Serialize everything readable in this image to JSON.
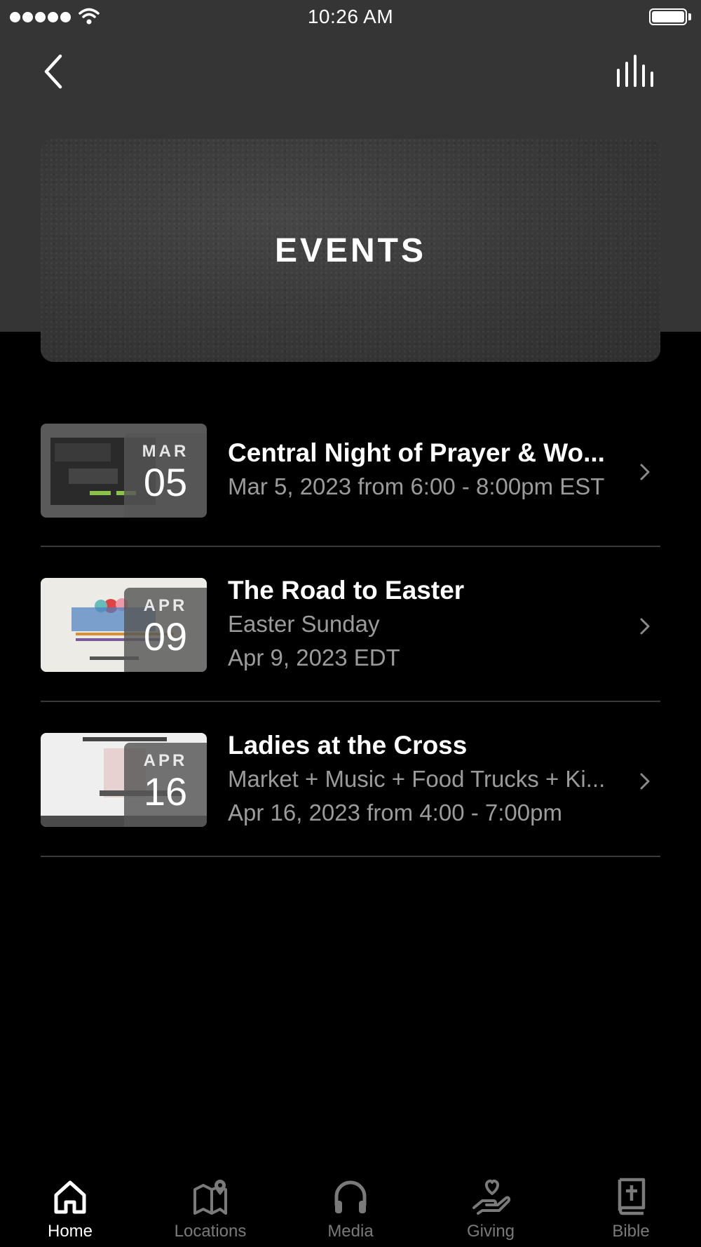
{
  "status_bar": {
    "time": "10:26 AM"
  },
  "header": {
    "back_icon": "chevron-left-icon",
    "audio_icon": "audio-bars-icon"
  },
  "banner": {
    "title": "EVENTS"
  },
  "events": [
    {
      "month": "MAR",
      "day": "05",
      "title": "Central Night of Prayer & Wo...",
      "line1": "Mar 5, 2023 from 6:00 - 8:00pm EST",
      "line2": ""
    },
    {
      "month": "APR",
      "day": "09",
      "title": "The Road to Easter",
      "line1": "Easter Sunday",
      "line2": "Apr 9, 2023 EDT"
    },
    {
      "month": "APR",
      "day": "16",
      "title": "Ladies at the Cross",
      "line1": "Market + Music + Food Trucks + Ki...",
      "line2": "Apr 16, 2023 from 4:00 - 7:00pm"
    }
  ],
  "tabs": [
    {
      "label": "Home",
      "icon": "home-icon",
      "active": true
    },
    {
      "label": "Locations",
      "icon": "map-pin-icon",
      "active": false
    },
    {
      "label": "Media",
      "icon": "headphones-icon",
      "active": false
    },
    {
      "label": "Giving",
      "icon": "hand-heart-icon",
      "active": false
    },
    {
      "label": "Bible",
      "icon": "bible-icon",
      "active": false
    }
  ],
  "colors": {
    "background": "#000000",
    "header_background": "#353535",
    "secondary_text": "#9b9b9b",
    "inactive_tab": "#7a7a7a"
  }
}
